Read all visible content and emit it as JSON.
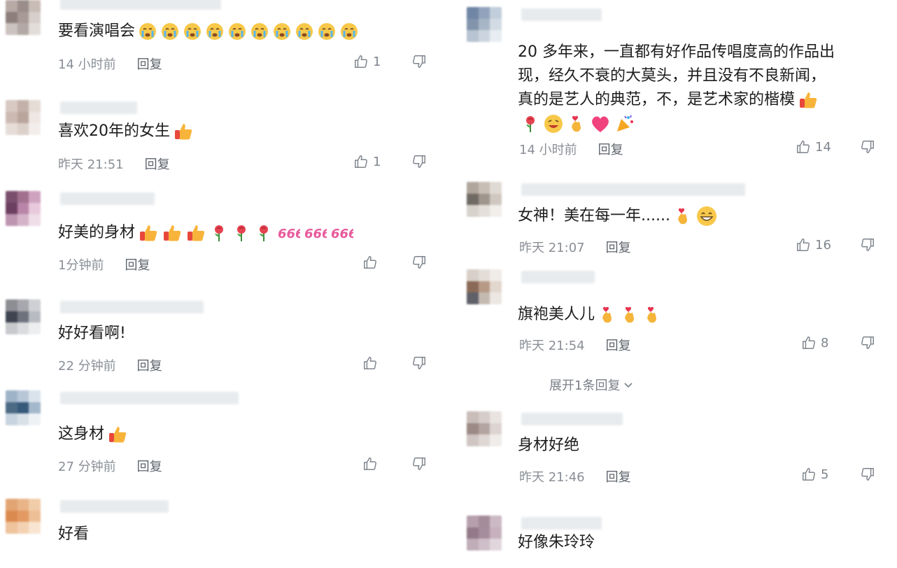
{
  "left_comments": [
    {
      "text": "要看演唱会",
      "time": "14 小时前",
      "reply": "回复",
      "likes": "1",
      "emoji": [
        "cry",
        "cry",
        "cry",
        "cry",
        "cry",
        "cry",
        "cry",
        "cry",
        "cry",
        "cry"
      ]
    },
    {
      "text": "喜欢20年的女生",
      "time": "昨天 21:51",
      "reply": "回复",
      "likes": "1",
      "emoji": [
        "thumbs"
      ]
    },
    {
      "text": "好美的身材",
      "time": "1分钟前",
      "reply": "回复",
      "likes": "",
      "emoji": [
        "thumbs",
        "thumbs",
        "thumbs",
        "rose",
        "rose",
        "rose",
        "six",
        "six",
        "six"
      ]
    },
    {
      "text": "好好看啊!",
      "time": "22 分钟前",
      "reply": "回复",
      "likes": "",
      "emoji": []
    },
    {
      "text": "这身材",
      "time": "27 分钟前",
      "reply": "回复",
      "likes": "",
      "emoji": [
        "thumbs"
      ]
    },
    {
      "text": "好看",
      "time": "",
      "reply": "",
      "likes": "",
      "emoji": []
    }
  ],
  "right_comments": [
    {
      "lines": [
        "20 多年来，一直都有好作品传唱度高的作品出",
        "现，经久不衰的大莫头，并且没有不良新闻，",
        "真的是艺人的典范，不，是艺术家的楷模"
      ],
      "time": "14 小时前",
      "reply": "回复",
      "likes": "14",
      "emoji": [
        "rose",
        "grin",
        "fingerheart",
        "heart",
        "party"
      ]
    },
    {
      "lines": [
        "女神！美在每一年......"
      ],
      "time": "昨天 21:07",
      "reply": "回复",
      "likes": "16",
      "emoji": [
        "fingerheart",
        "smile"
      ]
    },
    {
      "lines": [
        "旗袍美人儿"
      ],
      "time": "昨天 21:54",
      "reply": "回复",
      "likes": "8",
      "emoji": [
        "fingerheart",
        "fingerheart",
        "fingerheart"
      ]
    },
    {
      "lines": [
        "身材好绝"
      ],
      "time": "昨天 21:46",
      "reply": "回复",
      "likes": "5",
      "emoji": []
    },
    {
      "lines": [
        "好像朱玲玲"
      ],
      "time": "",
      "reply": "",
      "likes": "",
      "emoji": []
    }
  ],
  "expand_replies": "展开1条回复",
  "icons": {
    "like": "thumbs-up-icon",
    "dislike": "thumbs-down-icon",
    "expand": "chevron-down-icon"
  },
  "colors": {
    "text": "#1d1d1d",
    "meta": "#8a8f96",
    "icon": "#7f858d",
    "background": "#ffffff"
  }
}
